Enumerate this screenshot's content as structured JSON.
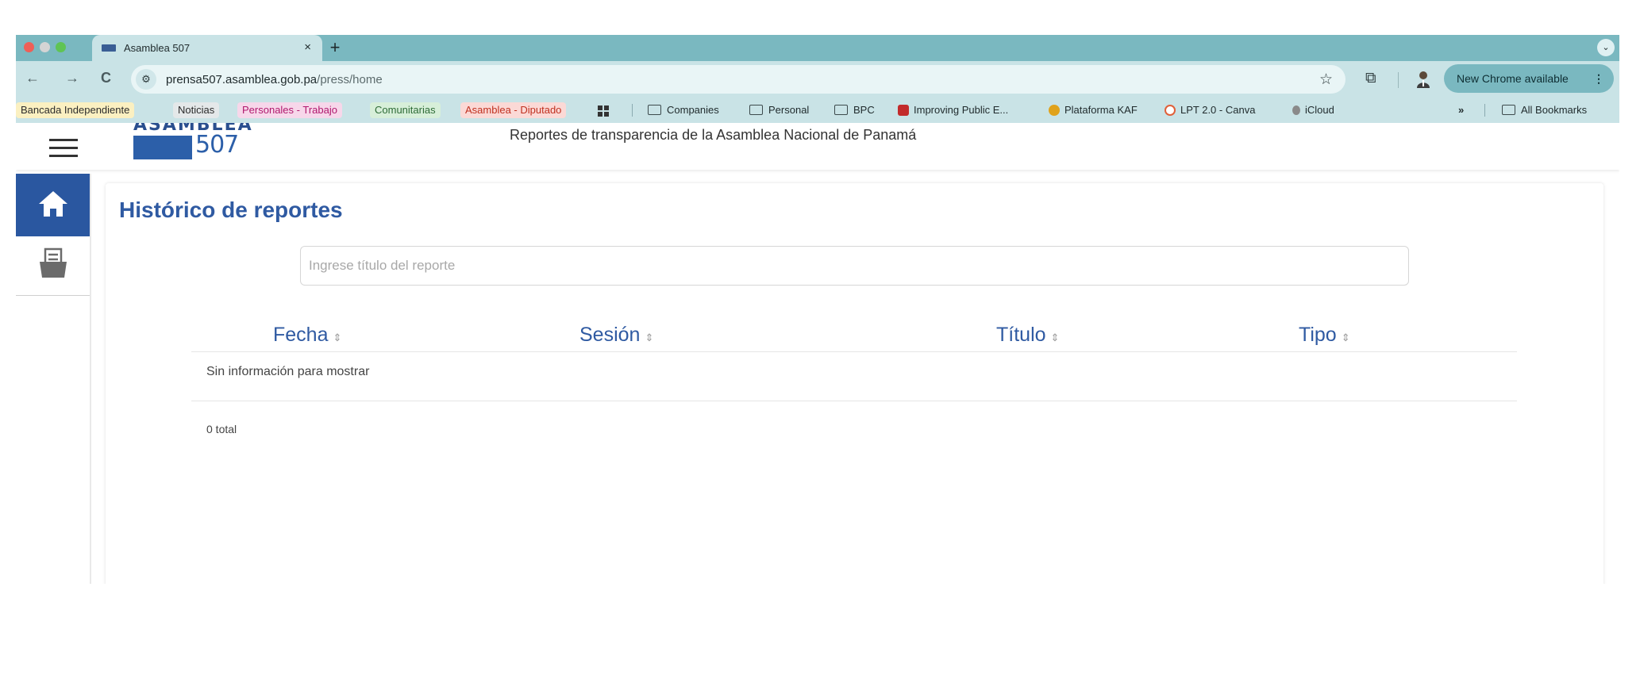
{
  "browser": {
    "tab": {
      "title": "Asamblea 507",
      "close": "×"
    },
    "new_tab": "+",
    "tab_menu": "⌄",
    "nav": {
      "back": "←",
      "forward": "→",
      "reload": "C"
    },
    "url": {
      "host": "prensa507.asamblea.gob.pa",
      "path": "/press/home"
    },
    "update_button": "New Chrome available",
    "update_menu": "⋮",
    "bookmarks": {
      "chips": [
        "Bancada Independiente",
        "Noticias",
        "Personales - Trabajo",
        "Comunitarias",
        "Asamblea - Diputado"
      ],
      "folders": [
        "Companies",
        "Personal",
        "BPC"
      ],
      "links": [
        "Improving Public E...",
        "Plataforma KAF",
        "LPT 2.0 - Canva",
        "iCloud"
      ],
      "overflow": "»",
      "all": "All Bookmarks"
    },
    "colors": {
      "frame": "#7ab8c0",
      "toolbar": "#c9e3e6"
    }
  },
  "app": {
    "logo_top": "ASAMBLEA",
    "logo_number": "507",
    "subtitle": "Reportes de transparencia de la Asamblea Nacional de Panamá",
    "sidebar": [
      {
        "name": "home",
        "icon": "home-icon",
        "active": true
      },
      {
        "name": "documents",
        "icon": "folder-docs-icon",
        "active": false
      }
    ],
    "card": {
      "title": "Histórico de reportes",
      "search_placeholder": "Ingrese título del reporte",
      "columns": [
        "Fecha",
        "Sesión",
        "Título",
        "Tipo"
      ],
      "sort_glyph": "⇕",
      "empty_message": "Sin información para mostrar",
      "total": "0 total"
    },
    "colors": {
      "primary": "#2f5aa2",
      "sidebar_active": "#2a57a0"
    }
  }
}
